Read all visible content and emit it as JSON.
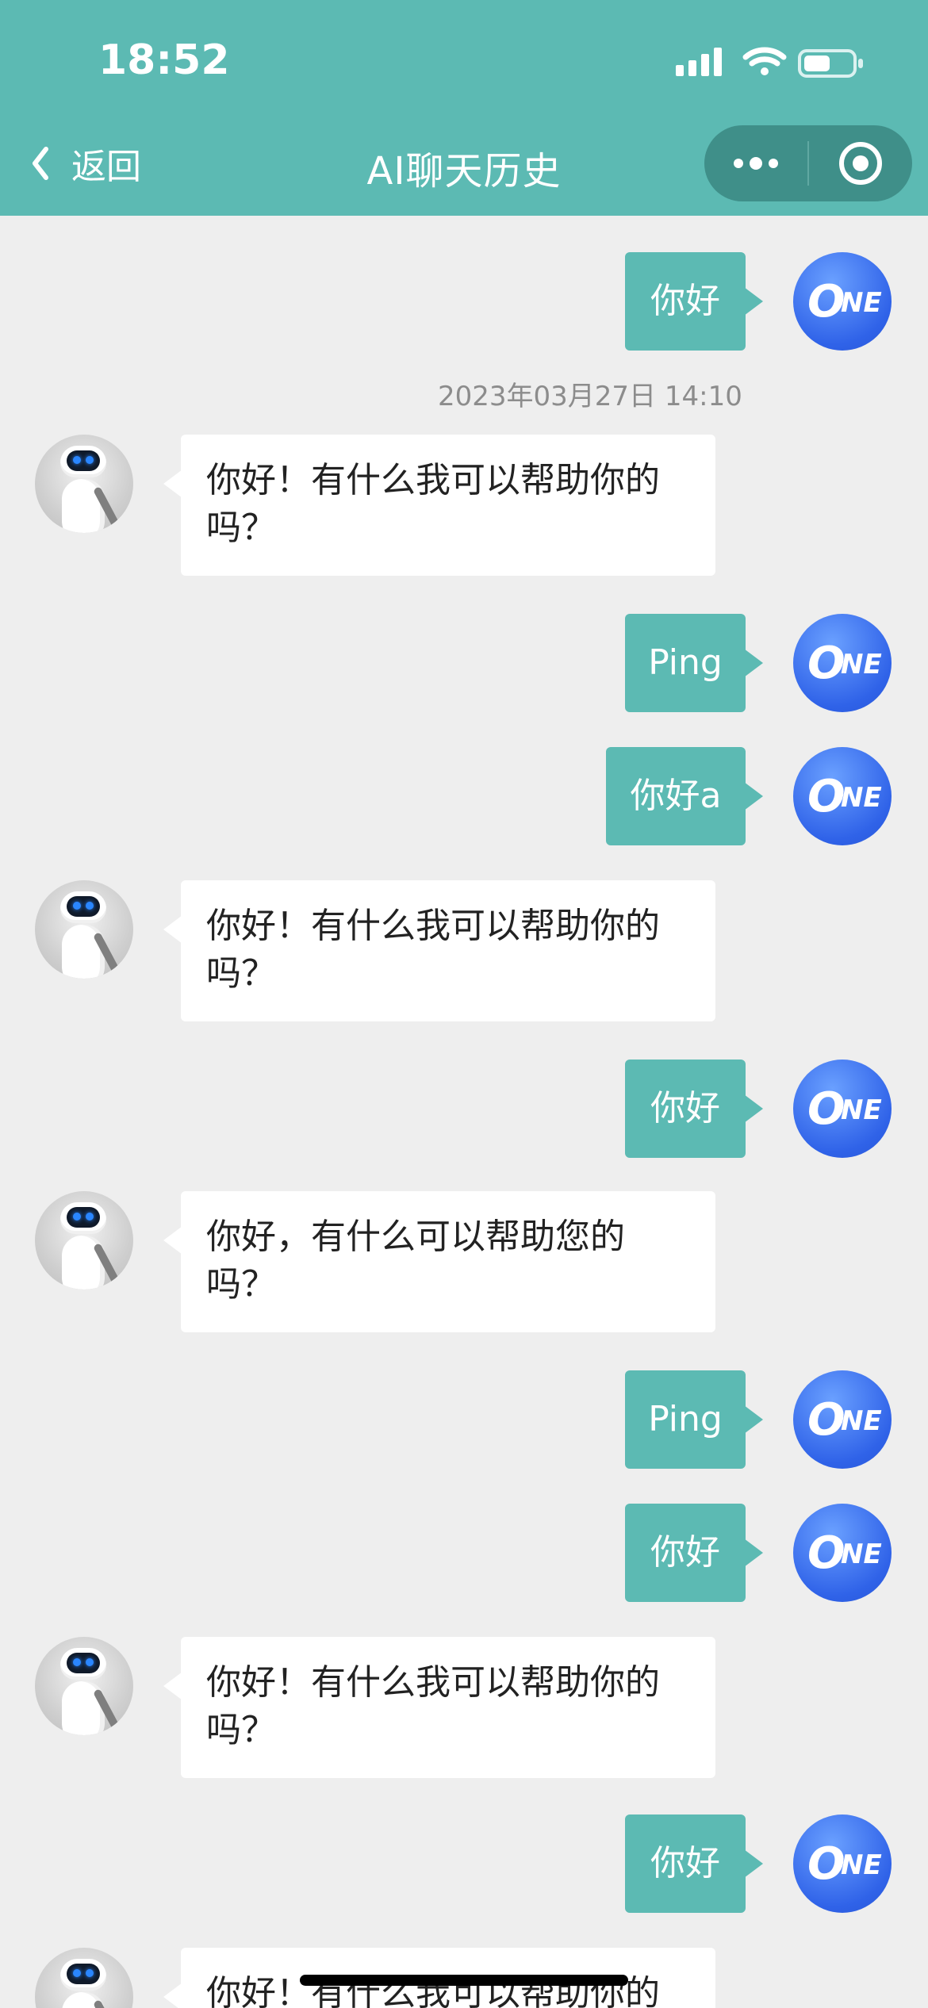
{
  "status_bar": {
    "time": "18:52"
  },
  "nav": {
    "back_label": "返回",
    "title": "AI聊天历史"
  },
  "capsule": {
    "more_icon": "more-icon",
    "record_icon": "record-icon"
  },
  "chat": {
    "timestamp": "2023年03月27日 14:10",
    "messages": [
      {
        "from": "user",
        "text": "你好"
      },
      {
        "from": "bot",
        "text": "你好！有什么我可以帮助你的吗？"
      },
      {
        "from": "user",
        "text": "Ping"
      },
      {
        "from": "user",
        "text": "你好a"
      },
      {
        "from": "bot",
        "text": "你好！有什么我可以帮助你的吗？"
      },
      {
        "from": "user",
        "text": "你好"
      },
      {
        "from": "bot",
        "text": "你好，有什么可以帮助您的吗？"
      },
      {
        "from": "user",
        "text": "Ping"
      },
      {
        "from": "user",
        "text": "你好"
      },
      {
        "from": "bot",
        "text": "你好！有什么我可以帮助你的吗？"
      },
      {
        "from": "user",
        "text": "你好"
      },
      {
        "from": "bot",
        "text": "你好！有什么我可以帮助你的吗？"
      }
    ]
  },
  "colors": {
    "primary": "#5cbab3",
    "background": "#eeeeee"
  }
}
